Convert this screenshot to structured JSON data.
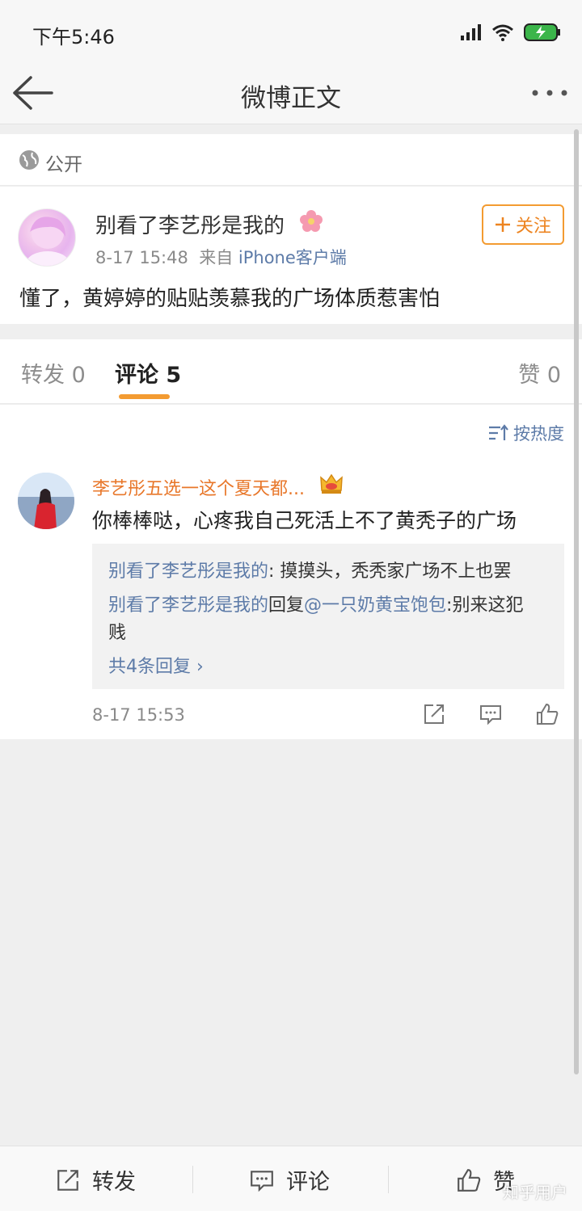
{
  "status_bar": {
    "time": "下午5:46"
  },
  "nav": {
    "title": "微博正文"
  },
  "visibility": {
    "label": "公开"
  },
  "post": {
    "author": "别看了李艺彤是我的",
    "time": "8-17 15:48",
    "source_prefix": "来自",
    "source": "iPhone客户端",
    "follow_label": "关注",
    "text": "懂了，黄婷婷的贴贴羡慕我的广场体质惹害怕"
  },
  "tabs": {
    "repost": "转发 0",
    "comment": "评论 5",
    "like": "赞 0"
  },
  "sort": {
    "label": "按热度"
  },
  "comment": {
    "author": "李艺彤五选一这个夏天都...",
    "text": "你棒棒哒，心疼我自己死活上不了黄秃子的广场",
    "time": "8-17 15:53",
    "replies": {
      "r1_user": "别看了李艺彤是我的",
      "r1_text": ": 摸摸头，秃秃家广场不上也罢",
      "r2_user": "别看了李艺彤是我的",
      "r2_mid": "回复",
      "r2_target": "@一只奶黄宝饱包",
      "r2_text": ":别来这犯",
      "r3_text": "贱",
      "more": "共4条回复 ›"
    }
  },
  "bottom_bar": {
    "repost": "转发",
    "comment": "评论",
    "like": "赞"
  },
  "watermark": "知乎用户",
  "colors": {
    "accent": "#f39b31",
    "link": "#5d7ba8",
    "name_orange": "#e8772a"
  }
}
